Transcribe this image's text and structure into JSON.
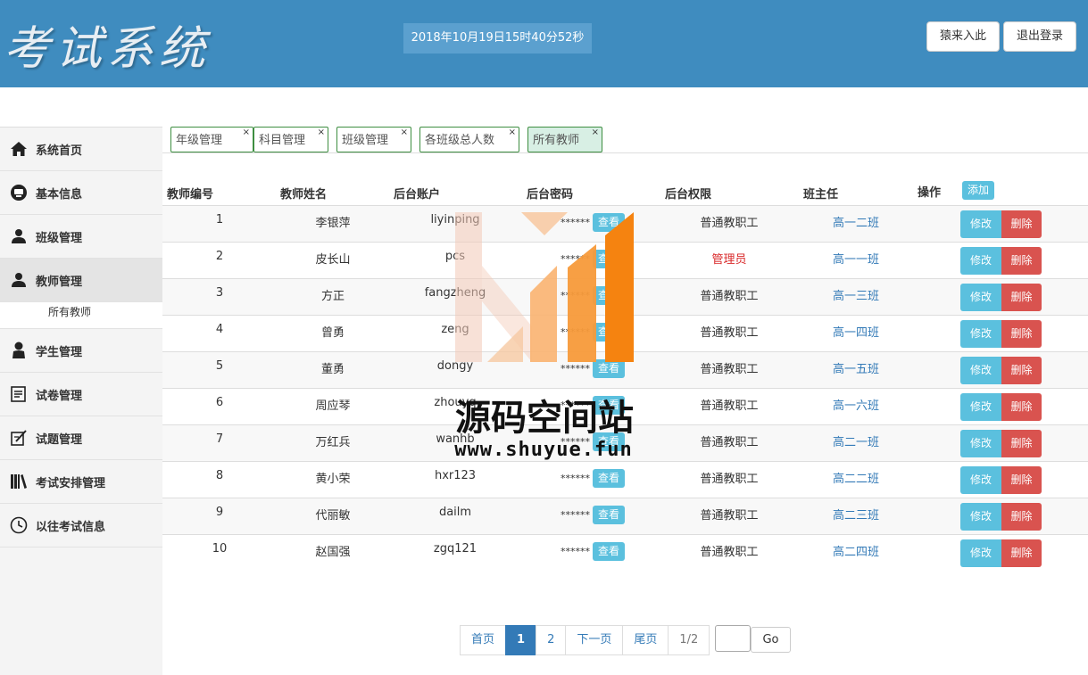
{
  "header": {
    "logo": "考试系统",
    "datetime": "2018年10月19日15时40分52秒",
    "btn_enter": "猿来入此",
    "btn_logout": "退出登录"
  },
  "sidebar": {
    "items": [
      {
        "label": "系统首页",
        "icon": "home-icon"
      },
      {
        "label": "基本信息",
        "icon": "info-icon"
      },
      {
        "label": "班级管理",
        "icon": "user-icon"
      },
      {
        "label": "教师管理",
        "icon": "user-icon"
      },
      {
        "label": "学生管理",
        "icon": "user-icon"
      },
      {
        "label": "试卷管理",
        "icon": "paper-icon"
      },
      {
        "label": "试题管理",
        "icon": "edit-icon"
      },
      {
        "label": "考试安排管理",
        "icon": "books-icon"
      },
      {
        "label": "以往考试信息",
        "icon": "clock-icon"
      }
    ],
    "sub_all_teachers": "所有教师"
  },
  "tabs": [
    "年级管理",
    "科目管理",
    "班级管理",
    "各班级总人数",
    "所有教师"
  ],
  "tab_close": "×",
  "table": {
    "headers": [
      "教师编号",
      "教师姓名",
      "后台账户",
      "后台密码",
      "后台权限",
      "班主任",
      "操作"
    ],
    "add_label": "添加",
    "view_label": "查看",
    "edit_label": "修改",
    "delete_label": "删除",
    "pwd_mask": "******",
    "rows": [
      {
        "id": "1",
        "name": "李银萍",
        "account": "liyinping",
        "role": "普通教职工",
        "class": "高一二班"
      },
      {
        "id": "2",
        "name": "皮长山",
        "account": "pcs",
        "role": "管理员",
        "class": "高一一班"
      },
      {
        "id": "3",
        "name": "方正",
        "account": "fangzheng",
        "role": "普通教职工",
        "class": "高一三班"
      },
      {
        "id": "4",
        "name": "曾勇",
        "account": "zeng",
        "role": "普通教职工",
        "class": "高一四班"
      },
      {
        "id": "5",
        "name": "董勇",
        "account": "dongy",
        "role": "普通教职工",
        "class": "高一五班"
      },
      {
        "id": "6",
        "name": "周应琴",
        "account": "zhouyq",
        "role": "普通教职工",
        "class": "高一六班"
      },
      {
        "id": "7",
        "name": "万红兵",
        "account": "wanhb",
        "role": "普通教职工",
        "class": "高二一班"
      },
      {
        "id": "8",
        "name": "黄小荣",
        "account": "hxr123",
        "role": "普通教职工",
        "class": "高二二班"
      },
      {
        "id": "9",
        "name": "代丽敏",
        "account": "dailm",
        "role": "普通教职工",
        "class": "高二三班"
      },
      {
        "id": "10",
        "name": "赵国强",
        "account": "zgq121",
        "role": "普通教职工",
        "class": "高二四班"
      }
    ]
  },
  "pager": {
    "first": "首页",
    "p1": "1",
    "p2": "2",
    "next": "下一页",
    "last": "尾页",
    "info": "1/2",
    "go": "Go"
  },
  "watermark": {
    "title": "源码空间站",
    "url": "www.shuyue.fun"
  },
  "colors": {
    "header_bg": "#3f8cbf",
    "accent_info": "#5bc0de",
    "danger": "#d9534f",
    "primary": "#337ab7",
    "admin_role": "#d9292a"
  }
}
